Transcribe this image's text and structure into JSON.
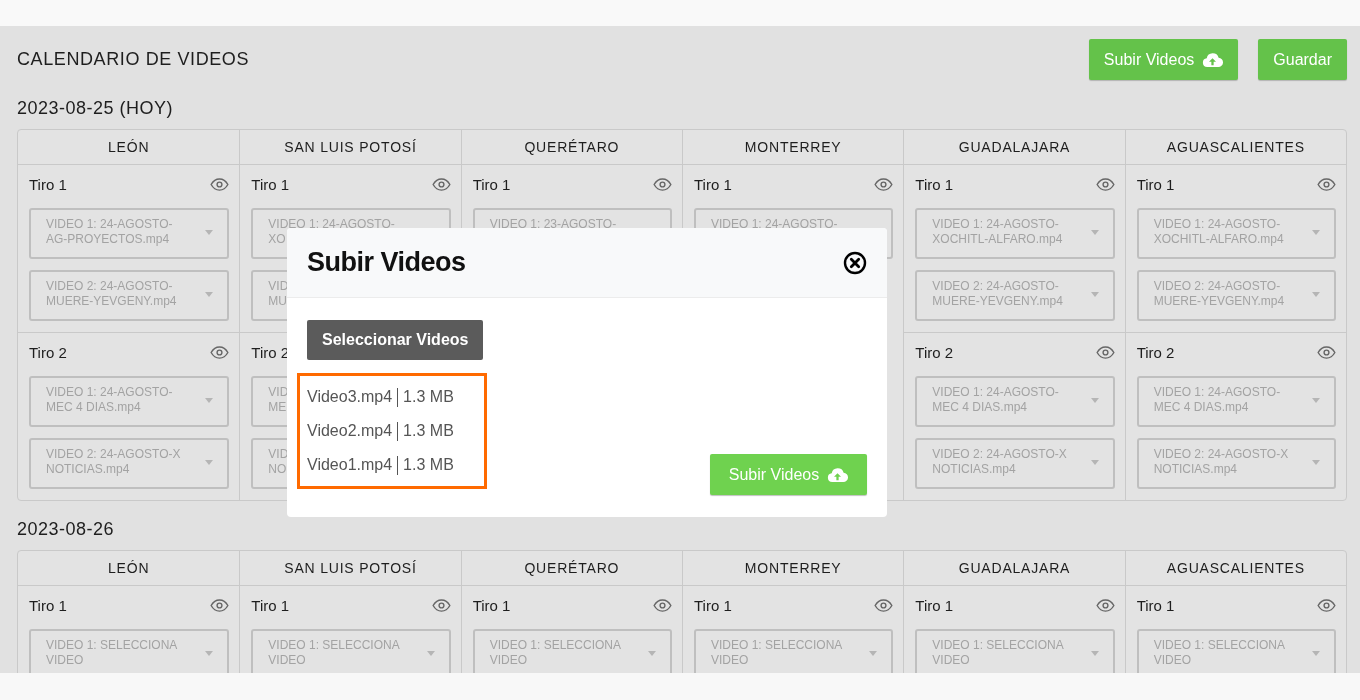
{
  "page": {
    "title": "CALENDARIO DE VIDEOS",
    "upload_button": "Subir Videos",
    "save_button": "Guardar"
  },
  "days": [
    {
      "date": "2023-08-25 (HOY)",
      "columns": [
        {
          "city": "LEÓN",
          "tiros": [
            {
              "title": "Tiro 1",
              "eye": true,
              "selects": [
                {
                  "value": "VIDEO 1: 24-AGOSTO-AG-PROYECTOS.mp4"
                },
                {
                  "value": "VIDEO 2: 24-AGOSTO-MUERE-YEVGENY.mp4"
                }
              ]
            },
            {
              "title": "Tiro 2",
              "eye": true,
              "selects": [
                {
                  "value": "VIDEO 1: 24-AGOSTO-MEC 4 DIAS.mp4"
                },
                {
                  "value": "VIDEO 2: 24-AGOSTO-X NOTICIAS.mp4"
                }
              ]
            }
          ]
        },
        {
          "city": "SAN LUIS POTOSÍ",
          "tiros": [
            {
              "title": "Tiro 1",
              "eye": true,
              "selects": [
                {
                  "value": "VIDEO 1: 24-AGOSTO-XO"
                },
                {
                  "value": "VID\nMU"
                }
              ]
            },
            {
              "title": "Tiro 2",
              "eye": false,
              "selects": [
                {
                  "value": "VID\nME"
                },
                {
                  "value": "VID\nNO"
                }
              ]
            }
          ]
        },
        {
          "city": "QUERÉTARO",
          "tiros": [
            {
              "title": "Tiro 1",
              "eye": true,
              "selects": [
                {
                  "value": "VIDEO 1: 23-AGOSTO-"
                }
              ]
            }
          ]
        },
        {
          "city": "MONTERREY",
          "tiros": [
            {
              "title": "Tiro 1",
              "eye": true,
              "selects": [
                {
                  "value": "VIDEO 1: 24-AGOSTO-"
                }
              ]
            }
          ]
        },
        {
          "city": "GUADALAJARA",
          "tiros": [
            {
              "title": "Tiro 1",
              "eye": true,
              "selects": [
                {
                  "value": "VIDEO 1: 24-AGOSTO-XOCHITL-ALFARO.mp4"
                },
                {
                  "value": "VIDEO 2: 24-AGOSTO-MUERE-YEVGENY.mp4"
                }
              ]
            },
            {
              "title": "Tiro 2",
              "eye": true,
              "selects": [
                {
                  "value": "VIDEO 1: 24-AGOSTO-MEC 4 DIAS.mp4"
                },
                {
                  "value": "VIDEO 2: 24-AGOSTO-X NOTICIAS.mp4"
                }
              ]
            }
          ]
        },
        {
          "city": "AGUASCALIENTES",
          "tiros": [
            {
              "title": "Tiro 1",
              "eye": true,
              "selects": [
                {
                  "value": "VIDEO 1: 24-AGOSTO-XOCHITL-ALFARO.mp4"
                },
                {
                  "value": "VIDEO 2: 24-AGOSTO-MUERE-YEVGENY.mp4"
                }
              ]
            },
            {
              "title": "Tiro 2",
              "eye": true,
              "selects": [
                {
                  "value": "VIDEO 1: 24-AGOSTO-MEC 4 DIAS.mp4"
                },
                {
                  "value": "VIDEO 2: 24-AGOSTO-X NOTICIAS.mp4"
                }
              ]
            }
          ]
        }
      ]
    },
    {
      "date": "2023-08-26",
      "columns": [
        {
          "city": "LEÓN",
          "tiros": [
            {
              "title": "Tiro 1",
              "eye": true,
              "selects": [
                {
                  "value": "VIDEO 1: SELECCIONA VIDEO"
                }
              ]
            }
          ]
        },
        {
          "city": "SAN LUIS POTOSÍ",
          "tiros": [
            {
              "title": "Tiro 1",
              "eye": true,
              "selects": [
                {
                  "value": "VIDEO 1: SELECCIONA VIDEO"
                }
              ]
            }
          ]
        },
        {
          "city": "QUERÉTARO",
          "tiros": [
            {
              "title": "Tiro 1",
              "eye": true,
              "selects": [
                {
                  "value": "VIDEO 1: SELECCIONA VIDEO"
                }
              ]
            }
          ]
        },
        {
          "city": "MONTERREY",
          "tiros": [
            {
              "title": "Tiro 1",
              "eye": true,
              "selects": [
                {
                  "value": "VIDEO 1: SELECCIONA VIDEO"
                }
              ]
            }
          ]
        },
        {
          "city": "GUADALAJARA",
          "tiros": [
            {
              "title": "Tiro 1",
              "eye": true,
              "selects": [
                {
                  "value": "VIDEO 1: SELECCIONA VIDEO"
                }
              ]
            }
          ]
        },
        {
          "city": "AGUASCALIENTES",
          "tiros": [
            {
              "title": "Tiro 1",
              "eye": true,
              "selects": [
                {
                  "value": "VIDEO 1: SELECCIONA VIDEO"
                }
              ]
            }
          ]
        }
      ]
    }
  ],
  "modal": {
    "title": "Subir Videos",
    "select_button": "Seleccionar Videos",
    "files": [
      {
        "name": "Video3.mp4",
        "size": "1.3 MB"
      },
      {
        "name": "Video2.mp4",
        "size": "1.3 MB"
      },
      {
        "name": "Video1.mp4",
        "size": "1.3 MB"
      }
    ],
    "upload_button": "Subir Videos"
  }
}
